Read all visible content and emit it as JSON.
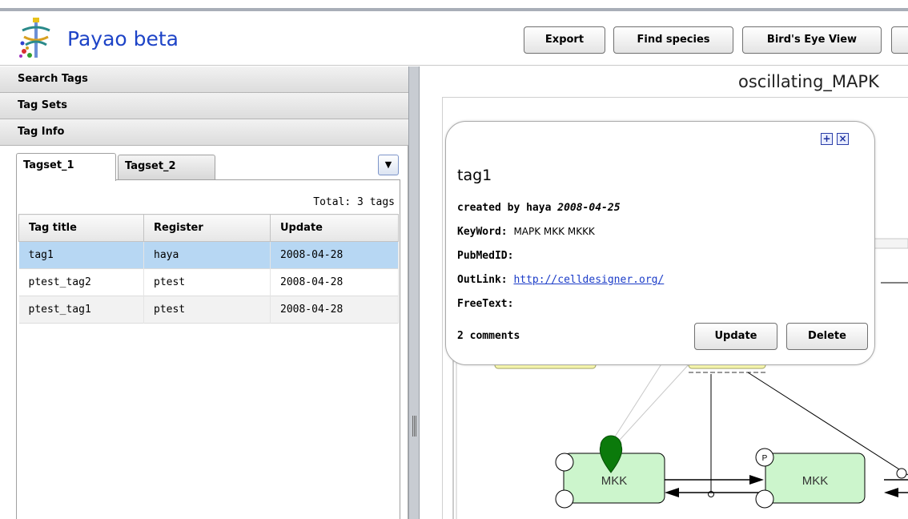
{
  "app": {
    "title": "Payao beta"
  },
  "header": {
    "buttons": {
      "export": "Export",
      "find_species": "Find species",
      "birds_eye": "Bird's Eye View"
    }
  },
  "sidebar": {
    "sections": {
      "search_tags": "Search Tags",
      "tag_sets": "Tag Sets",
      "tag_info": "Tag Info"
    },
    "tabs": [
      "Tagset_1",
      "Tagset_2"
    ],
    "active_tab": "Tagset_1",
    "total": "Total: 3 tags",
    "table": {
      "columns": [
        "Tag title",
        "Register",
        "Update"
      ],
      "rows": [
        {
          "title": "tag1",
          "register": "haya",
          "update": "2008-04-28",
          "selected": true
        },
        {
          "title": "ptest_tag2",
          "register": "ptest",
          "update": "2008-04-28",
          "selected": false
        },
        {
          "title": "ptest_tag1",
          "register": "ptest",
          "update": "2008-04-28",
          "selected": false
        }
      ]
    }
  },
  "diagram": {
    "title": "oscillating_MAPK",
    "nodes": [
      {
        "label": "MKK",
        "state": ""
      },
      {
        "label": "MKK",
        "state": "P"
      }
    ]
  },
  "popup": {
    "tag_name": "tag1",
    "created_label": "created by",
    "created_by": "haya",
    "created_date": "2008-04-25",
    "keyword_label": "KeyWord:",
    "keywords": "MAPK MKK MKKK",
    "pubmed_label": "PubMedID:",
    "pubmed_value": "",
    "outlink_label": "OutLink:",
    "outlink_url": "http://celldesigner.org/",
    "freetext_label": "FreeText:",
    "freetext_value": "",
    "comments": "2 comments",
    "update_button": "Update",
    "delete_button": "Delete"
  },
  "colors": {
    "title_blue": "#1e44c7",
    "selected_row": "#b7d7f3",
    "species_fill": "#ccf5cc",
    "marker_green": "#0b7a0b",
    "link_blue": "#1b3cc8"
  }
}
